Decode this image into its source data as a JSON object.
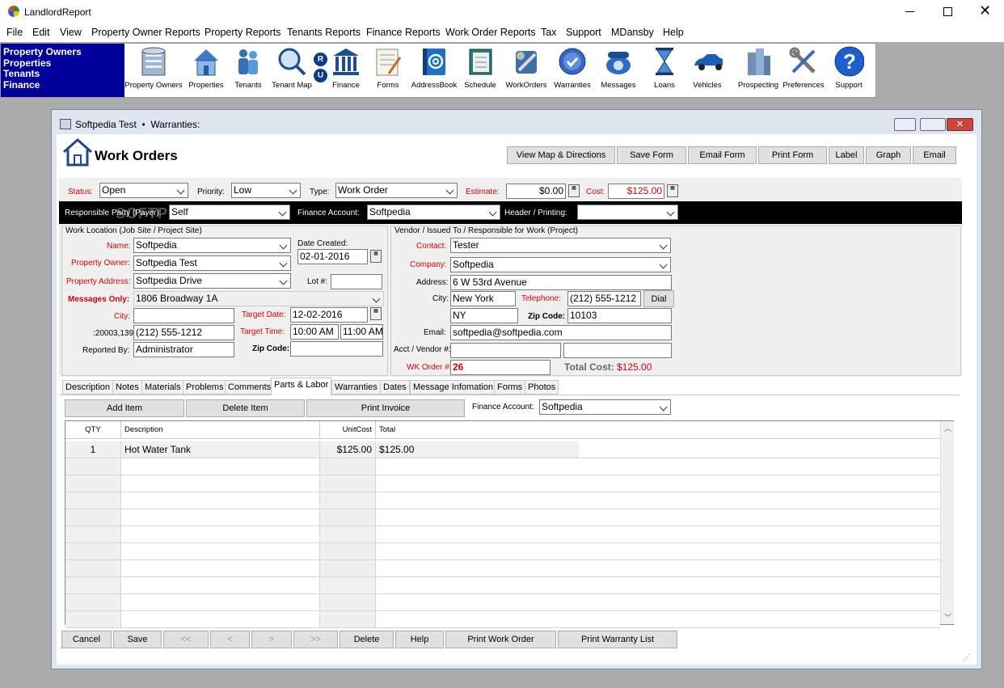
{
  "app": {
    "title": "LandlordReport"
  },
  "menu": [
    "File",
    "Edit",
    "View",
    "Property Owner Reports",
    "Property Reports",
    "Tenants Reports",
    "Finance Reports",
    "Work Order Reports",
    "Tax",
    "Support",
    "MDansby",
    "Help"
  ],
  "quicknav": [
    "Property Owners",
    "Properties",
    "Tenants",
    "Finance"
  ],
  "toolbar": {
    "items": [
      "Property Owners",
      "Properties",
      "Tenants",
      "Tenant Map",
      "Finance",
      "Forms",
      "AddressBook",
      "Schedule",
      "WorkOrders",
      "Warranties",
      "Messages",
      "Loans",
      "Vehicles",
      "Prospecting",
      "Preferences",
      "Support"
    ],
    "ru_letters": [
      "R",
      "U"
    ]
  },
  "window": {
    "title": "Softpedia Test  •  Warranties:",
    "heading": "Work Orders"
  },
  "actions": [
    "View Map & Directions",
    "Save Form",
    "Email Form",
    "Print Form",
    "Label",
    "Graph",
    "Email"
  ],
  "status_row": {
    "status_label": "Status:",
    "status": "Open",
    "priority_label": "Priority:",
    "priority": "Low",
    "type_label": "Type:",
    "type": "Work Order",
    "estimate_label": "Estimate:",
    "estimate": "$0.00",
    "cost_label": "Cost:",
    "cost": "$125.00"
  },
  "black_row": {
    "responsible_label": "Responsible Party (Payer):",
    "responsible": "Self",
    "finance_label": "Finance Account:",
    "finance": "Softpedia",
    "header_label": "Header / Printing:",
    "header": ""
  },
  "left": {
    "section": "Work Location (Job Site /  Project Site)",
    "name_label": "Name:",
    "name": "Softpedia",
    "owner_label": "Property Owner:",
    "owner": "Softpedia Test",
    "address_label": "Property Address:",
    "address": "Softpedia Drive",
    "messages_label": "Messages Only:",
    "messages": "1806 Broadway 1A",
    "city_label": "City:",
    "city": "",
    "phone_label": ":20003,139",
    "phone": "(212) 555-1212",
    "reported_label": "Reported By:",
    "reported": "Administrator",
    "date_created_label": "Date Created:",
    "date_created": "02-01-2016",
    "lot_label": "Lot #:",
    "lot": "",
    "target_date_label": "Target Date:",
    "target_date": "12-02-2016",
    "target_time_label": "Target Time:",
    "time_start": "10:00 AM",
    "time_end": "11:00 AM",
    "zip_label": "Zip Code:",
    "zip": ""
  },
  "vendor": {
    "section": "Vendor / Issued To / Responsible for Work (Project)",
    "contact_label": "Contact:",
    "contact": "Tester",
    "company_label": "Company:",
    "company": "Softpedia",
    "address_label": "Address:",
    "address": "6 W 53rd Avenue",
    "city_label": "City:",
    "city": "New York",
    "telephone_label": "Telephone:",
    "telephone": "(212) 555-1212",
    "dial": "Dial",
    "state": "NY",
    "zip_label": "Zip Code:",
    "zip": "10103",
    "email_label": "Email:",
    "email": "softpedia@softpedia.com",
    "acct_label": "Acct / Vendor #:",
    "acct1": "",
    "acct2": "",
    "wk_label": "WK Order #:",
    "wk": "26",
    "total_label": "Total Cost:",
    "total": "$125.00"
  },
  "tabs": [
    "Description",
    "Notes",
    "Materials",
    "Problems",
    "Comments",
    "Parts & Labor",
    "Warranties",
    "Dates",
    "Message Infomation",
    "Forms",
    "Photos"
  ],
  "parts": {
    "add": "Add Item",
    "delete": "Delete Item",
    "print": "Print Invoice",
    "finance_label": "Finance Account:",
    "finance": "Softpedia",
    "columns": [
      "QTY",
      "Description",
      "UnitCost",
      "Total"
    ],
    "rows": [
      {
        "qty": "1",
        "desc": "Hot Water Tank",
        "unit": "$125.00",
        "total": "$125.00"
      }
    ]
  },
  "bottom": [
    "Cancel",
    "Save",
    "<<",
    "<",
    ">",
    ">>",
    "Delete",
    "Help",
    "Print Work Order",
    "Print Warranty List"
  ],
  "watermark": "SOFTPEDIA",
  "colors": {
    "quicknav_bg": "#00009a",
    "label_red": "#d00000",
    "black_bar": "#000000"
  }
}
